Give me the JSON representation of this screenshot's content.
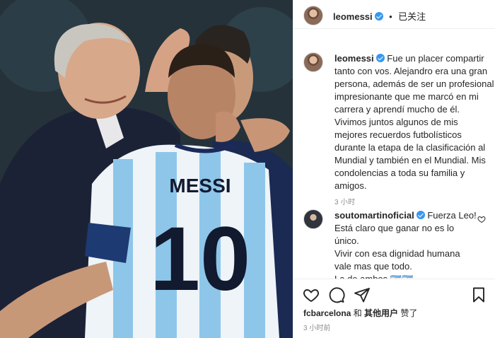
{
  "post": {
    "username": "leomessi",
    "separator": "•",
    "follow_state": "已关注"
  },
  "caption": {
    "username": "leomessi",
    "lines": [
      "Fue un placer compartir",
      "tanto con vos. Alejandro era una gran",
      "persona, además de ser un profesional",
      "impresionante que me marcó en mi",
      "carrera y aprendí mucho de él.",
      "Vivimos juntos algunos de mis",
      "mejores recuerdos futbolísticos",
      "durante la etapa de la clasificación al",
      "Mundial y también en el Mundial. Mis",
      "condolencias a toda su familia y",
      "amigos."
    ],
    "time": "3 小时"
  },
  "comment": {
    "username": "soutomartinoficial",
    "lines": [
      "Fuerza Leo!",
      "Está claro que ganar no es lo",
      "único.",
      "Vivir con esa dignidad humana",
      "vale mas que todo.",
      "La de ambos.🇦🇷🇦🇷"
    ]
  },
  "likes": {
    "user": "fcbarcelona",
    "text": " 和 ",
    "others": "其他用户",
    "suffix": " 赞了"
  },
  "post_time": "3 小时前",
  "photo": {
    "jersey_name": "MESSI",
    "jersey_number": "10"
  },
  "colors": {
    "accent": "#3897f0",
    "jersey_blue": "#8ec6ea"
  },
  "icons": {
    "like": "heart-icon",
    "comment": "comment-icon",
    "share": "paper-plane-icon",
    "save": "bookmark-icon"
  }
}
